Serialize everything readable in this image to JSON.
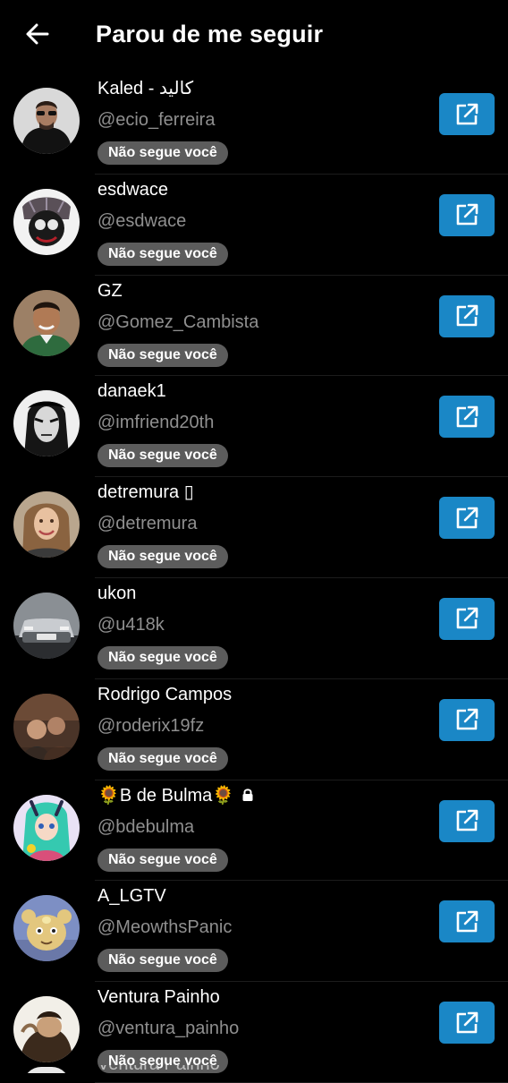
{
  "header": {
    "title": "Parou de me seguir",
    "back_icon": "arrow-left-icon"
  },
  "colors": {
    "background": "#000000",
    "accent_button": "#1a87c6",
    "badge_background": "#5c5c5c",
    "handle_text": "#8f8f8f"
  },
  "users": [
    {
      "name": "Kaled - كاليد",
      "handle": "@ecio_ferreira",
      "badge": "Não segue você",
      "action_icon": "external-link-icon"
    },
    {
      "name": "esdwace",
      "handle": "@esdwace",
      "badge": "Não segue você",
      "action_icon": "external-link-icon"
    },
    {
      "name": "GZ",
      "handle": "@Gomez_Cambista",
      "badge": "Não segue você",
      "action_icon": "external-link-icon"
    },
    {
      "name": "danaek1",
      "handle": "@imfriend20th",
      "badge": "Não segue você",
      "action_icon": "external-link-icon"
    },
    {
      "name": "detremura ▯",
      "handle": "@detremura",
      "badge": "Não segue você",
      "action_icon": "external-link-icon"
    },
    {
      "name": "ukon",
      "handle": "@u418k",
      "badge": "Não segue você",
      "action_icon": "external-link-icon"
    },
    {
      "name": "Rodrigo Campos",
      "handle": "@roderix19fz",
      "badge": "Não segue você",
      "action_icon": "external-link-icon"
    },
    {
      "name": "🌻B de Bulma🌻",
      "handle": "@bdebulma",
      "badge": "Não segue você",
      "action_icon": "external-link-icon",
      "locked": true
    },
    {
      "name": "A_LGTV",
      "handle": "@MeowthsPanic",
      "badge": "Não segue você",
      "action_icon": "external-link-icon"
    },
    {
      "name": "Ventura Painho",
      "handle": "@ventura_painho",
      "badge": "Não segue você",
      "action_icon": "external-link-icon"
    }
  ],
  "partial_row": {
    "name": "Ventura Painho"
  }
}
